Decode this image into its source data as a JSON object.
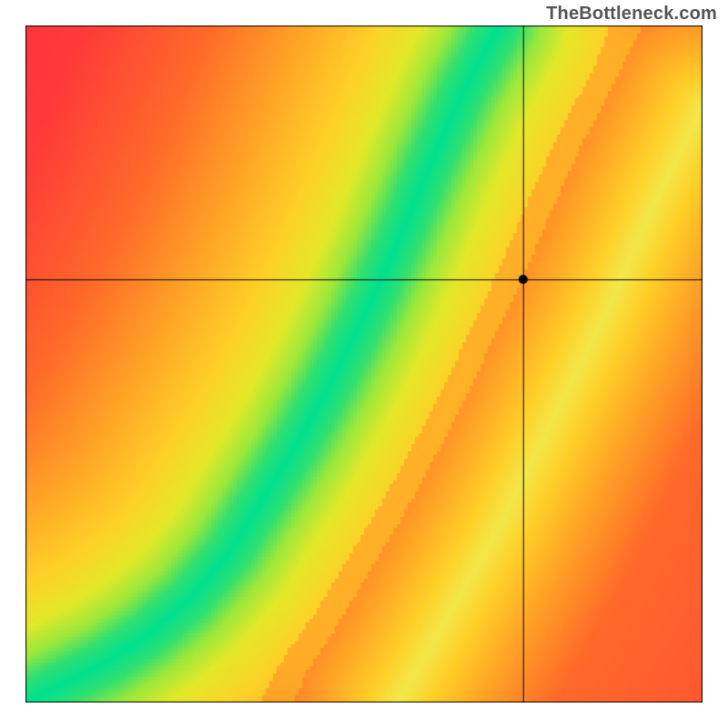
{
  "watermark": "TheBottleneck.com",
  "chart_data": {
    "type": "heatmap",
    "title": "",
    "xlabel": "",
    "ylabel": "",
    "x_range": [
      0,
      1
    ],
    "y_range": [
      0,
      1
    ],
    "resolution_note": "values are normalized 0..1 in both axes; canvas origin is top-left, so plot y_frac = 1 - y",
    "ridge_curve_note": "green optimal ridge: piecewise curve — starts at (0,0), convex bulge to ~(0.32,0.25), then near-linear to (0.70,1.0). second fainter yellow ridge runs from ~(0.55,0) to (1.0,0.88).",
    "ridge_primary": [
      [
        0.0,
        0.0
      ],
      [
        0.06,
        0.03
      ],
      [
        0.12,
        0.06
      ],
      [
        0.18,
        0.1
      ],
      [
        0.24,
        0.15
      ],
      [
        0.3,
        0.22
      ],
      [
        0.35,
        0.3
      ],
      [
        0.4,
        0.38
      ],
      [
        0.45,
        0.47
      ],
      [
        0.5,
        0.57
      ],
      [
        0.55,
        0.68
      ],
      [
        0.6,
        0.8
      ],
      [
        0.65,
        0.91
      ],
      [
        0.7,
        1.0
      ]
    ],
    "ridge_secondary": [
      [
        0.55,
        0.0
      ],
      [
        0.62,
        0.12
      ],
      [
        0.7,
        0.26
      ],
      [
        0.78,
        0.42
      ],
      [
        0.86,
        0.58
      ],
      [
        0.93,
        0.74
      ],
      [
        1.0,
        0.88
      ]
    ],
    "crosshair": {
      "x": 0.735,
      "y": 0.625
    },
    "marker": {
      "x": 0.735,
      "y": 0.625
    },
    "color_scale_note": "0 = deep red (#ff0044-ish), transitions through orange, yellow to green (#00d37a) at ridge",
    "color_stops": [
      {
        "d": 0.0,
        "hex": "#00e090"
      },
      {
        "d": 0.03,
        "hex": "#32e070"
      },
      {
        "d": 0.06,
        "hex": "#9ae83c"
      },
      {
        "d": 0.1,
        "hex": "#e4e82a"
      },
      {
        "d": 0.16,
        "hex": "#ffd028"
      },
      {
        "d": 0.25,
        "hex": "#ffa726"
      },
      {
        "d": 0.38,
        "hex": "#ff6a2a"
      },
      {
        "d": 0.55,
        "hex": "#ff3a3a"
      },
      {
        "d": 1.0,
        "hex": "#ff1a4a"
      }
    ],
    "secondary_color_stops": [
      {
        "d": 0.0,
        "hex": "#f4e84a"
      },
      {
        "d": 0.04,
        "hex": "#ffd028"
      },
      {
        "d": 0.1,
        "hex": "#ffa726"
      },
      {
        "d": 0.2,
        "hex": "#ff6a2a"
      },
      {
        "d": 1.0,
        "hex": "#ff1a4a"
      }
    ]
  }
}
